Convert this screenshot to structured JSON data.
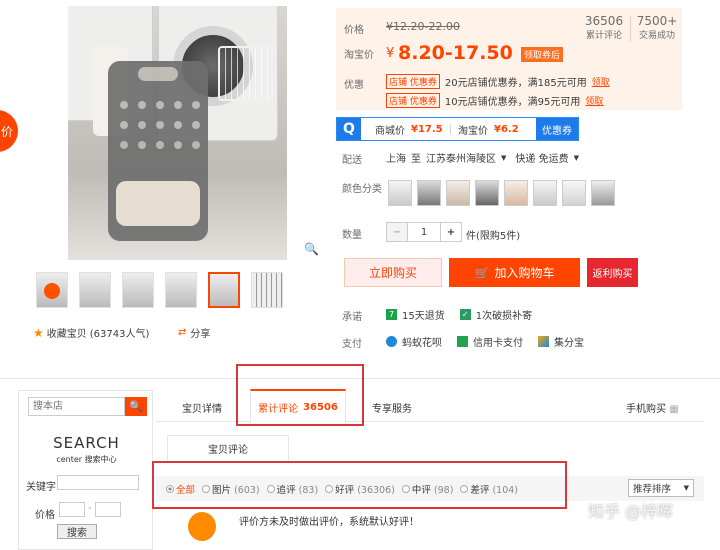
{
  "left_float_tab": "价",
  "gallery": {
    "favorite_label": "收藏宝贝",
    "favorite_count": "(63743人气)",
    "share_label": "分享"
  },
  "price": {
    "original_label": "价格",
    "original_value": "¥12.20-22.00",
    "taobao_label": "淘宝价",
    "currency": "¥",
    "taobao_value": "8.20-17.50",
    "coupon_badge": "领取券后",
    "review_count": "36506",
    "review_count_label": "累计评论",
    "sales_count": "7500+",
    "sales_label": "交易成功",
    "promo_label": "优惠",
    "coupons": [
      {
        "tag1": "店铺",
        "tag2": "优惠券",
        "text": "20元店铺优惠券，满185元可用",
        "link": "领取"
      },
      {
        "tag1": "店铺",
        "tag2": "优惠券",
        "text": "10元店铺优惠券，满95元可用",
        "link": "领取"
      }
    ]
  },
  "compare": {
    "logo": "Q",
    "mall_label": "商城价",
    "mall_price": "¥17.5",
    "tb_label": "淘宝价",
    "tb_price": "¥6.2",
    "button": "优惠券"
  },
  "shipping": {
    "label": "配送",
    "from": "上海",
    "to_word": "至",
    "to": "江苏泰州海陵区",
    "method": "快递 免运费"
  },
  "color_label": "颜色分类",
  "quantity": {
    "label": "数量",
    "minus": "−",
    "value": "1",
    "plus": "+",
    "unit": "件(限购5件)"
  },
  "buttons": {
    "buy_now": "立即购买",
    "add_cart": "加入购物车",
    "return_buy": "返利购买"
  },
  "promise": {
    "label": "承诺",
    "items": [
      "15天退货",
      "1次破损补寄"
    ]
  },
  "payment": {
    "label": "支付",
    "items": [
      "蚂蚁花呗",
      "信用卡支付",
      "集分宝"
    ]
  },
  "tabs": {
    "detail": "宝贝详情",
    "reviews": "累计评论",
    "reviews_count": "36506",
    "service": "专享服务",
    "mobile": "手机购买"
  },
  "store_search": {
    "placeholder": "搜本店",
    "brand": "SEARCH",
    "brand_sub": "center 搜索中心",
    "keyword_label": "关键字",
    "price_label": "价格",
    "search_button": "搜索"
  },
  "review_panel": {
    "tab": "宝贝评论",
    "filters": [
      {
        "label": "全部",
        "count": ""
      },
      {
        "label": "图片",
        "count": "(603)"
      },
      {
        "label": "追评",
        "count": "(83)"
      },
      {
        "label": "好评",
        "count": "(36306)"
      },
      {
        "label": "中评",
        "count": "(98)"
      },
      {
        "label": "差评",
        "count": "(104)"
      }
    ],
    "sort": "推荐排序",
    "first_review": "评价方未及时做出评价，系统默认好评！"
  },
  "watermark": "知乎 @梓晖",
  "colors": {
    "accent": "#ff4400",
    "annotation": "#d9373b",
    "blue": "#1d7bea"
  }
}
